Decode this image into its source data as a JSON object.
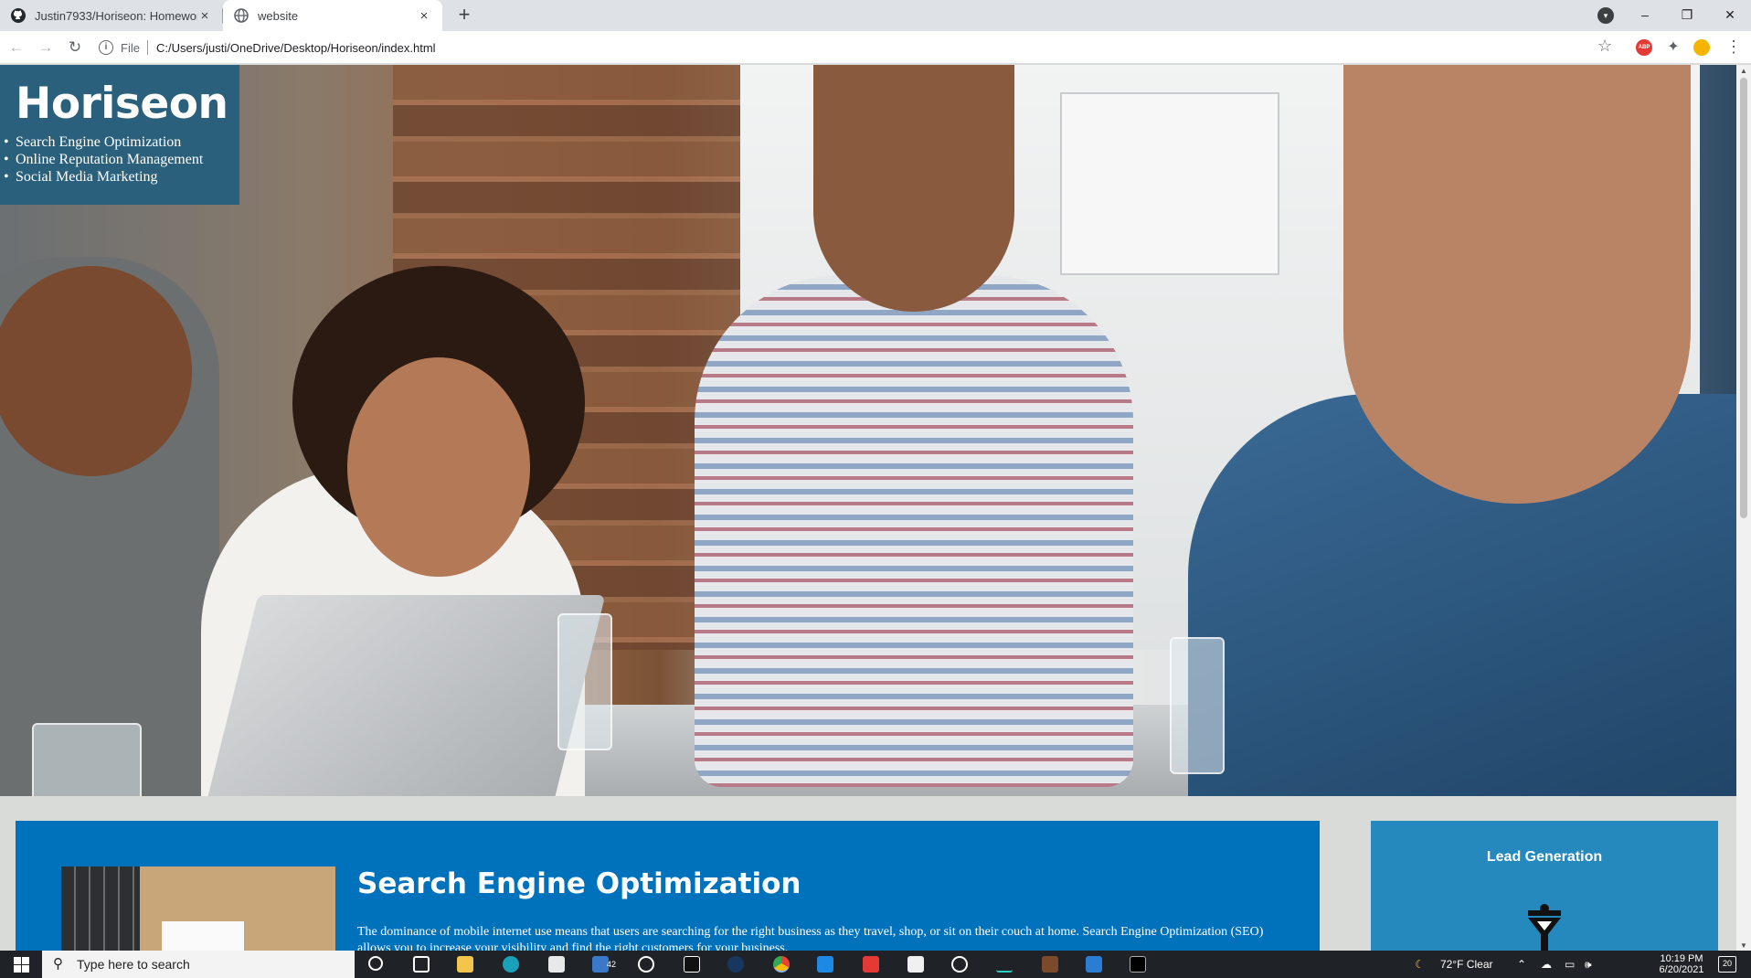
{
  "browser": {
    "tabs": [
      {
        "title": "Justin7933/Horiseon: Homework",
        "active": false,
        "close": "×"
      },
      {
        "title": "website",
        "active": true,
        "close": "×"
      }
    ],
    "new_tab": "+",
    "window_controls": {
      "minimize": "–",
      "restore": "❐",
      "close": "✕"
    },
    "address": {
      "scheme": "File",
      "url": "C:/Users/justi/OneDrive/Desktop/Horiseon/index.html"
    },
    "nav": {
      "back": "←",
      "forward": "→",
      "reload": "↻"
    },
    "icons": {
      "bookmark": "star-icon",
      "abp": "ABP",
      "extensions": "puzzle-icon",
      "menu": "⋮"
    }
  },
  "page": {
    "logo": "Horiseon",
    "nav": [
      "Search Engine Optimization",
      "Online Reputation Management",
      "Social Media Marketing"
    ],
    "section": {
      "title": "Search Engine Optimization",
      "body": "The dominance of mobile internet use means that users are searching for the right business as they travel, shop, or sit on their couch at home. Search Engine Optimization (SEO) allows you to increase your visibility and find the right customers for your business."
    },
    "aside": {
      "title": "Lead Generation"
    },
    "colors": {
      "header_bg": "#2a607c",
      "content_bg": "#0072bb",
      "aside_bg": "#2589bd",
      "page_bg": "#d9dbd8"
    }
  },
  "taskbar": {
    "search_placeholder": "Type here to search",
    "mail_badge": "42",
    "weather": "72°F  Clear",
    "time": "10:19 PM",
    "date": "6/20/2021",
    "notifications": "20"
  }
}
